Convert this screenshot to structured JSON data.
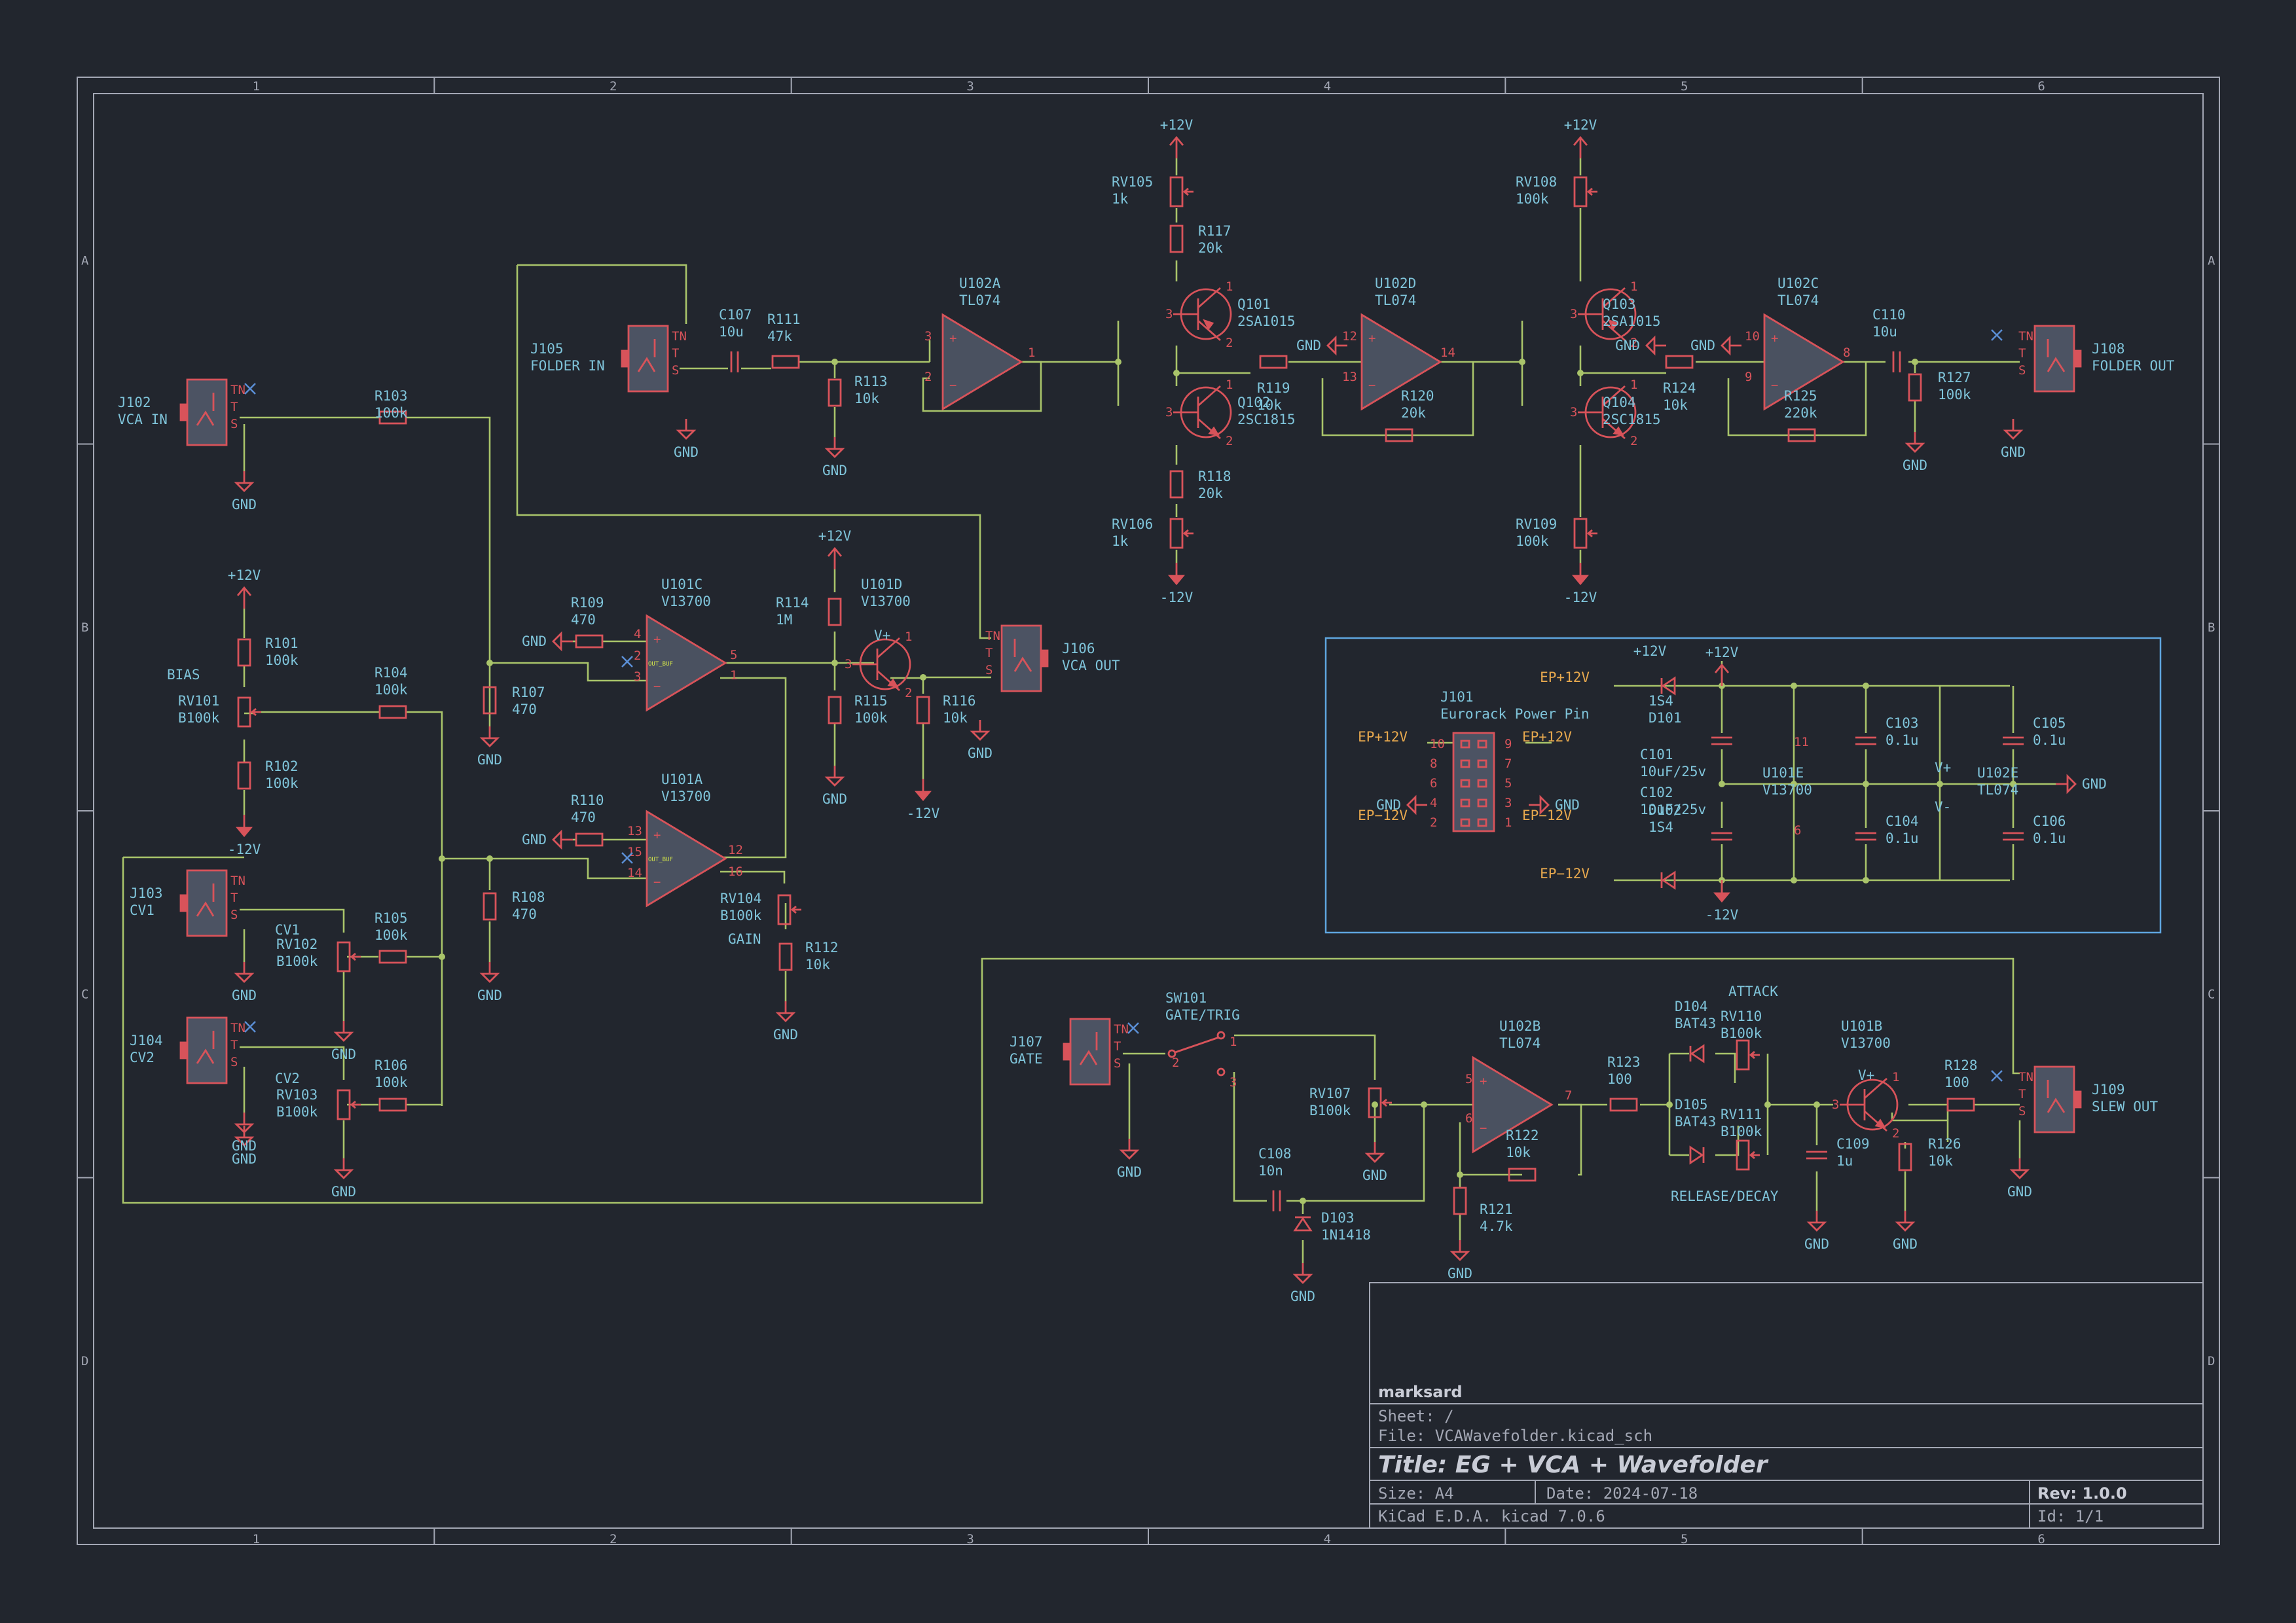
{
  "sheet": {
    "grid_cols": [
      "1",
      "2",
      "3",
      "4",
      "5",
      "6"
    ],
    "grid_rows": [
      "A",
      "B",
      "C",
      "D"
    ]
  },
  "title_block": {
    "company": "marksard",
    "sheet": "Sheet: /",
    "file": "File: VCAWavefolder.kicad_sch",
    "title": "Title: EG + VCA + Wavefolder",
    "size": "Size: A4",
    "date": "Date: 2024-07-18",
    "rev": "Rev: 1.0.0",
    "tool": "KiCad E.D.A.  kicad 7.0.6",
    "id": "Id: 1/1"
  },
  "colors": {
    "background": "#22262e",
    "wire": "#a9c46a",
    "symbol": "#d8535a",
    "reference": "#7fc4da",
    "net_label": "#e8a94e",
    "frame": "#a3a7b4"
  },
  "rails": {
    "pos": "+12V",
    "neg": "-12V",
    "gnd": "GND"
  },
  "pins": {
    "TN": "TN",
    "T": "T",
    "S": "S"
  },
  "components": {
    "J102": [
      "J102",
      "VCA IN"
    ],
    "J105": [
      "J105",
      "FOLDER IN"
    ],
    "J103": [
      "J103",
      "CV1"
    ],
    "J104": [
      "J104",
      "CV2"
    ],
    "J106": [
      "J106",
      "VCA OUT"
    ],
    "J107": [
      "J107",
      "GATE"
    ],
    "J108": [
      "J108",
      "FOLDER OUT"
    ],
    "J109": [
      "J109",
      "SLEW OUT"
    ],
    "C107": [
      "C107",
      "10u"
    ],
    "R111": [
      "R111",
      "47k"
    ],
    "R113": [
      "R113",
      "10k"
    ],
    "U102A": [
      "U102A",
      "TL074"
    ],
    "RV105": [
      "RV105",
      "1k"
    ],
    "R117": [
      "R117",
      "20k"
    ],
    "Q101": [
      "Q101",
      "2SA1015"
    ],
    "Q102": [
      "Q102",
      "2SC1815"
    ],
    "R118": [
      "R118",
      "20k"
    ],
    "RV106": [
      "RV106",
      "1k"
    ],
    "R119": [
      "R119",
      "10k"
    ],
    "U102D": [
      "U102D",
      "TL074"
    ],
    "R120": [
      "R120",
      "20k"
    ],
    "RV108": [
      "RV108",
      "100k"
    ],
    "Q103": [
      "Q103",
      "2SA1015"
    ],
    "Q104": [
      "Q104",
      "2SC1815"
    ],
    "RV109": [
      "RV109",
      "100k"
    ],
    "R124": [
      "R124",
      "10k"
    ],
    "U102C": [
      "U102C",
      "TL074"
    ],
    "R125": [
      "R125",
      "220k"
    ],
    "C110": [
      "C110",
      "10u"
    ],
    "R127": [
      "R127",
      "100k"
    ],
    "R103": [
      "R103",
      "100k"
    ],
    "R101": [
      "R101",
      "100k"
    ],
    "RV101": [
      "RV101",
      "B100k"
    ],
    "R102": [
      "R102",
      "100k"
    ],
    "R104": [
      "R104",
      "100k"
    ],
    "R109": [
      "R109",
      "470"
    ],
    "R107": [
      "R107",
      "470"
    ],
    "U101C": [
      "U101C",
      "V13700"
    ],
    "R114": [
      "R114",
      "1M"
    ],
    "U101D": [
      "U101D",
      "V13700"
    ],
    "R115": [
      "R115",
      "100k"
    ],
    "R116": [
      "R116",
      "10k"
    ],
    "R110": [
      "R110",
      "470"
    ],
    "R108": [
      "R108",
      "470"
    ],
    "U101A": [
      "U101A",
      "V13700"
    ],
    "RV104": [
      "RV104",
      "B100k"
    ],
    "R112": [
      "R112",
      "10k"
    ],
    "RV102": [
      "RV102",
      "B100k"
    ],
    "R105": [
      "R105",
      "100k"
    ],
    "RV103": [
      "RV103",
      "B100k"
    ],
    "R106": [
      "R106",
      "100k"
    ],
    "SW101": [
      "SW101",
      "GATE/TRIG"
    ],
    "RV107": [
      "RV107",
      "B100k"
    ],
    "C108": [
      "C108",
      "10n"
    ],
    "D103": [
      "D103",
      "1N1418"
    ],
    "U102B": [
      "U102B",
      "TL074"
    ],
    "R122": [
      "R122",
      "10k"
    ],
    "R121": [
      "R121",
      "4.7k"
    ],
    "R123": [
      "R123",
      "100"
    ],
    "D104": [
      "D104",
      "BAT43"
    ],
    "RV110": [
      "RV110",
      "B100k"
    ],
    "D105": [
      "D105",
      "BAT43"
    ],
    "RV111": [
      "RV111",
      "B100k"
    ],
    "C109": [
      "C109",
      "1u"
    ],
    "U101B": [
      "U101B",
      "V13700"
    ],
    "R128": [
      "R128",
      "100"
    ],
    "R126": [
      "R126",
      "10k"
    ],
    "J101": [
      "J101",
      "Eurorack Power Pin"
    ],
    "D101": [
      "1S4",
      "D101"
    ],
    "D102": [
      "D102",
      "1S4"
    ],
    "C101": [
      "C101",
      "10uF/25v"
    ],
    "C102": [
      "C102",
      "10uF/25v"
    ],
    "U101E": [
      "U101E",
      "V13700"
    ],
    "C103": [
      "C103",
      "0.1u"
    ],
    "C104": [
      "C104",
      "0.1u"
    ],
    "U102E": [
      "U102E",
      "TL074"
    ],
    "C105": [
      "C105",
      "0.1u"
    ],
    "C106": [
      "C106",
      "0.1u"
    ]
  },
  "labels": {
    "bias": "BIAS",
    "cv1": "CV1",
    "cv2": "CV2",
    "gain": "GAIN",
    "attack": "ATTACK",
    "release_decay": "RELEASE/DECAY",
    "ep12": "EP+12V",
    "epm12": "EP−12V",
    "vplus": "V+",
    "vminus": "V-",
    "ota_chip": "OUT_BUF"
  }
}
